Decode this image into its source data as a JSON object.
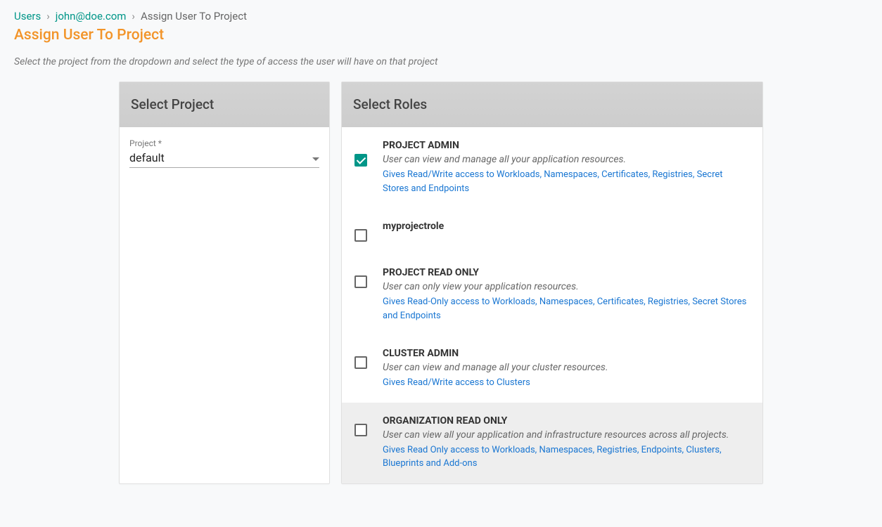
{
  "breadcrumb": {
    "items": [
      {
        "label": "Users",
        "link": true
      },
      {
        "label": "john@doe.com",
        "link": true
      },
      {
        "label": "Assign User To Project",
        "link": false
      }
    ],
    "separator": "›"
  },
  "page": {
    "title": "Assign User To Project",
    "subtitle": "Select the project from the dropdown and select the type of access the user will have on that project"
  },
  "project_panel": {
    "header": "Select Project",
    "field_label": "Project *",
    "selected": "default"
  },
  "roles_panel": {
    "header": "Select Roles",
    "roles": [
      {
        "name": "PROJECT ADMIN",
        "description": "User can view and manage all your application resources.",
        "access": "Gives Read/Write access to Workloads, Namespaces, Certificates, Registries, Secret Stores and Endpoints",
        "checked": true,
        "highlight": false
      },
      {
        "name": "myprojectrole",
        "description": "",
        "access": "",
        "checked": false,
        "highlight": false
      },
      {
        "name": "PROJECT READ ONLY",
        "description": "User can only view your application resources.",
        "access": "Gives Read-Only access to Workloads, Namespaces, Certificates, Registries, Secret Stores and Endpoints",
        "checked": false,
        "highlight": false
      },
      {
        "name": "CLUSTER ADMIN",
        "description": "User can view and manage all your cluster resources.",
        "access": "Gives Read/Write access to Clusters",
        "checked": false,
        "highlight": false
      },
      {
        "name": "ORGANIZATION READ ONLY",
        "description": "User can view all your application and infrastructure resources across all projects.",
        "access": "Gives Read Only access to Workloads, Namespaces, Registries, Endpoints, Clusters, Blueprints and Add-ons",
        "checked": false,
        "highlight": true
      }
    ]
  }
}
